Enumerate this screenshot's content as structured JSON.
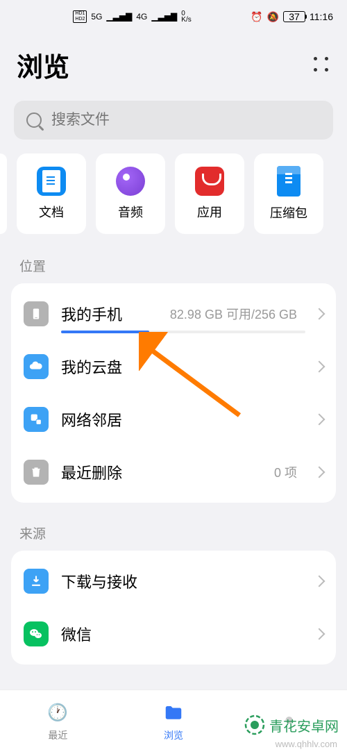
{
  "status": {
    "hd1": "HD1",
    "hd2": "HD2",
    "net1": "5G",
    "net2": "4G",
    "speed": "0",
    "speed_unit": "K/s",
    "battery_pct": "37",
    "time": "11:16"
  },
  "header": {
    "title": "浏览"
  },
  "search": {
    "placeholder": "搜索文件"
  },
  "categories": [
    {
      "label": "文档",
      "icon": "doc"
    },
    {
      "label": "音频",
      "icon": "audio"
    },
    {
      "label": "应用",
      "icon": "app"
    },
    {
      "label": "压缩包",
      "icon": "zip"
    }
  ],
  "sections": {
    "location": {
      "title": "位置",
      "items": [
        {
          "label": "我的手机",
          "detail": "82.98 GB 可用/256 GB",
          "icon": "phone",
          "storage": true
        },
        {
          "label": "我的云盘",
          "detail": "",
          "icon": "cloud"
        },
        {
          "label": "网络邻居",
          "detail": "",
          "icon": "network"
        },
        {
          "label": "最近删除",
          "detail": "0 项",
          "icon": "trash"
        }
      ]
    },
    "source": {
      "title": "来源",
      "items": [
        {
          "label": "下载与接收",
          "detail": "",
          "icon": "download"
        },
        {
          "label": "微信",
          "detail": "",
          "icon": "wechat"
        }
      ]
    }
  },
  "nav": {
    "recent": "最近",
    "browse": "浏览"
  },
  "watermark": {
    "brand": "青花安卓网",
    "url": "www.qhhlv.com"
  }
}
